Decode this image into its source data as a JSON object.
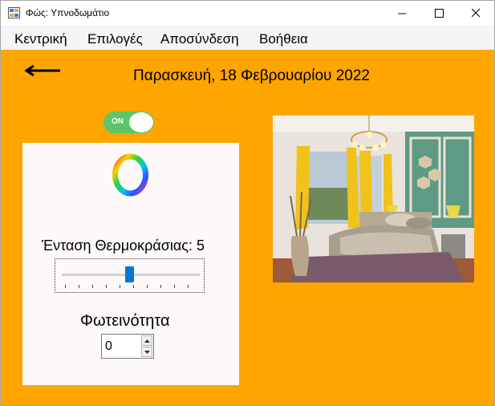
{
  "window": {
    "title": "Φώς: Υπνοδωμάτιο",
    "controls": [
      "minimize-icon",
      "maximize-icon",
      "close-icon"
    ]
  },
  "menu": {
    "items": [
      "Κεντρική",
      "Επιλογές",
      "Αποσύνδεση",
      "Βοήθεια"
    ]
  },
  "header": {
    "date": "Παρασκευή, 18 Φεβρουαρίου 2022",
    "back_icon": "arrow-left-icon"
  },
  "light_toggle": {
    "label": "ON",
    "state": "on",
    "color": "#5cc668"
  },
  "controls": {
    "color_picker_icon": "color-wheel-icon",
    "temperature_label": "Ένταση Θερμοκράσιας: 5",
    "temperature_value": 5,
    "temperature_range": [
      0,
      10
    ],
    "brightness_label": "Φωτεινότητα",
    "brightness_value": "0"
  },
  "colors": {
    "background": "#ffa500",
    "panel": "#fdf9f9",
    "slider_thumb": "#0078d7"
  },
  "image": {
    "subject": "bedroom-photo"
  }
}
